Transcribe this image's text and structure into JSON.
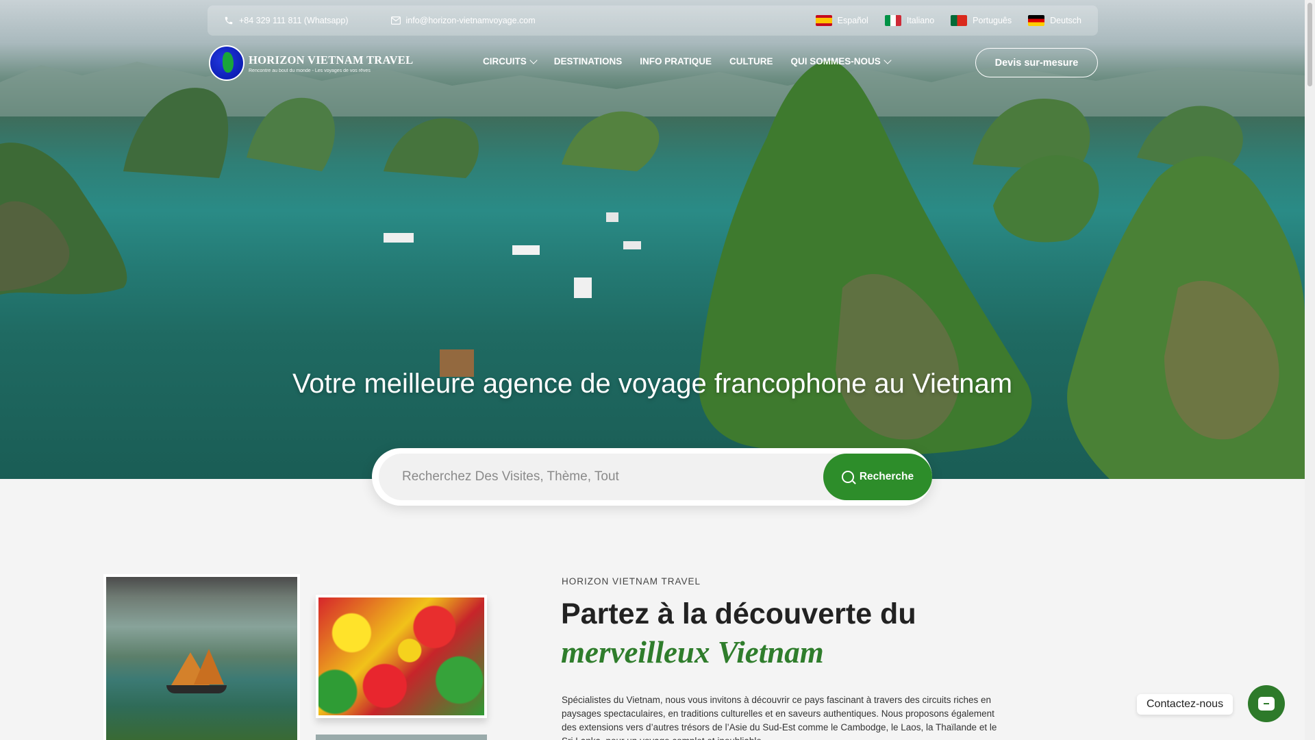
{
  "topbar": {
    "phone": "+84 329 111 811 (Whatsapp)",
    "email": "info@horizon-vietnamvoyage.com",
    "languages": [
      "Español",
      "Italiano",
      "Português",
      "Deutsch"
    ]
  },
  "logo": {
    "title": "HORIZON VIETNAM TRAVEL",
    "tagline": "Rencontre au bout du monde - Les voyages de vos rêves"
  },
  "nav": {
    "items": [
      "CIRCUITS",
      "DESTINATIONS",
      "INFO PRATIQUE",
      "CULTURE",
      "QUI SOMMES-NOUS"
    ],
    "cta": "Devis sur-mesure"
  },
  "hero": {
    "title": "Votre meilleure agence de voyage francophone au Vietnam"
  },
  "search": {
    "placeholder": "Recherchez Des Visites, Thème, Tout",
    "button": "Recherche"
  },
  "about": {
    "eyebrow": "HORIZON VIETNAM TRAVEL",
    "title": "Partez à la découverte du",
    "title_accent": "merveilleux Vietnam",
    "paragraph": "Spécialistes du Vietnam, nous vous invitons à découvrir ce pays fascinant à travers des circuits riches en paysages spectaculaires, en traditions culturelles et en saveurs authentiques. Nous proposons également des extensions vers d’autres trésors de l’Asie du Sud-Est comme le Cambodge, le Laos, la Thaïlande et le Sri Lanka, pour un voyage complet et inoubliable."
  },
  "contact": {
    "label": "Contactez-nous"
  },
  "colors": {
    "accent_green": "#2d8d2a",
    "title_green": "#2f7d2c"
  }
}
